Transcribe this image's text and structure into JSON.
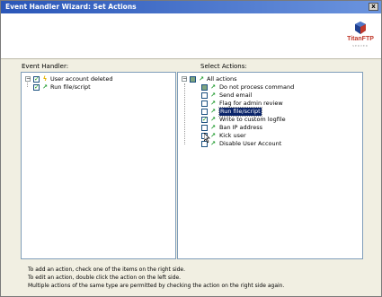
{
  "window": {
    "title": "Event Handler Wizard: Set Actions",
    "close_label": "x"
  },
  "logo": {
    "text": "TitanFTP",
    "subtext": "SERVER"
  },
  "event_handler": {
    "label": "Event Handler:",
    "items": [
      {
        "label": "User account deleted",
        "checked": true,
        "icon": "lightning-icon"
      },
      {
        "label": "Run file/script",
        "checked": true,
        "icon": "action-arrow-icon"
      }
    ]
  },
  "select_actions": {
    "label": "Select Actions:",
    "root": {
      "label": "All actions",
      "expander": "−",
      "state": "partial"
    },
    "items": [
      {
        "label": "Do not process command",
        "checked": false
      },
      {
        "label": "Send email",
        "checked": false
      },
      {
        "label": "Flag for admin review",
        "checked": false
      },
      {
        "label": "Run file/script",
        "checked": false,
        "selected": true
      },
      {
        "label": "Write to custom logfile",
        "checked": true
      },
      {
        "label": "Ban IP address",
        "checked": false
      },
      {
        "label": "Kick user",
        "checked": false
      },
      {
        "label": "Disable User Account",
        "checked": false
      }
    ]
  },
  "footer": {
    "lines": [
      "To add an action, check one of the items on the right side.",
      "To edit an action, double click the action on the left side.",
      "Multiple actions of the same type are permitted by checking the action on the right side again."
    ]
  },
  "colors": {
    "titlebar_start": "#2a56b8",
    "titlebar_end": "#6b94de",
    "selection": "#0a246a",
    "dialog_bg": "#f1efe2"
  }
}
